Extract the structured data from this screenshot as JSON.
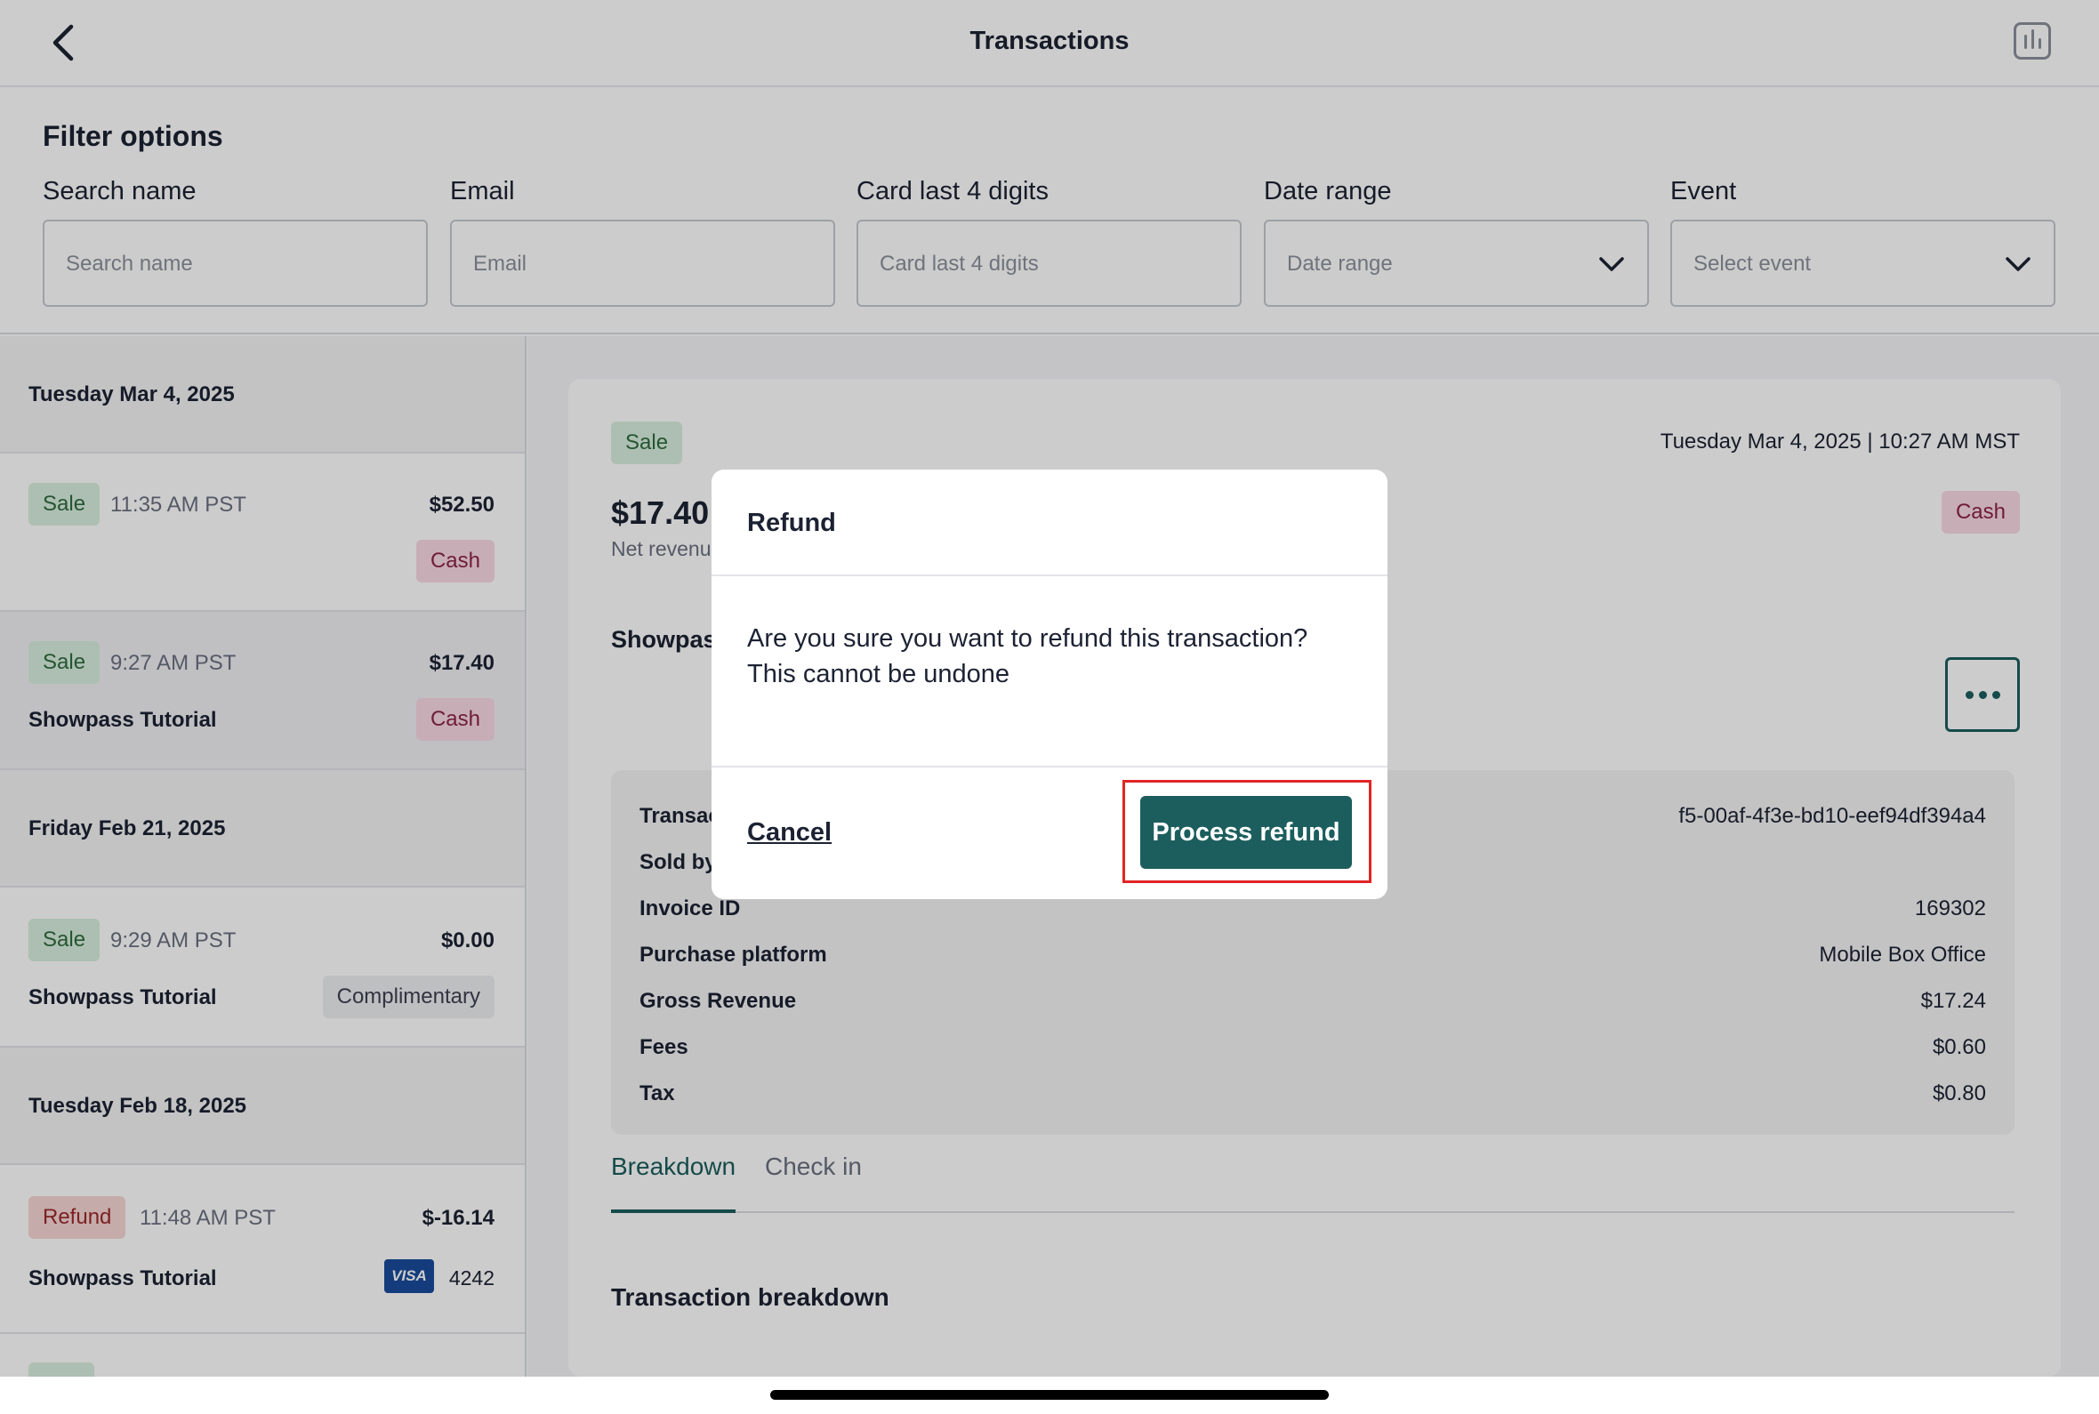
{
  "topbar": {
    "title": "Transactions",
    "back_icon": "chevron-left-icon",
    "report_icon": "bar-chart-icon"
  },
  "filters": {
    "title": "Filter options",
    "fields": [
      {
        "label": "Search name",
        "placeholder": "Search name",
        "type": "text"
      },
      {
        "label": "Email",
        "placeholder": "Email",
        "type": "text"
      },
      {
        "label": "Card last 4 digits",
        "placeholder": "Card last 4 digits",
        "type": "text"
      },
      {
        "label": "Date range",
        "placeholder": "Date range",
        "type": "select"
      },
      {
        "label": "Event",
        "placeholder": "Select event",
        "type": "select"
      }
    ]
  },
  "list": {
    "groups": [
      {
        "date": "Tuesday Mar 4, 2025",
        "items": [
          {
            "type": "Sale",
            "time": "11:35 AM PST",
            "amount": "$52.50",
            "event": "",
            "payment": "Cash"
          },
          {
            "type": "Sale",
            "time": "9:27 AM PST",
            "amount": "$17.40",
            "event": "Showpass Tutorial",
            "payment": "Cash",
            "selected": true
          }
        ]
      },
      {
        "date": "Friday Feb 21, 2025",
        "items": [
          {
            "type": "Sale",
            "time": "9:29 AM PST",
            "amount": "$0.00",
            "event": "Showpass Tutorial",
            "payment": "Complimentary"
          }
        ]
      },
      {
        "date": "Tuesday Feb 18, 2025",
        "items": [
          {
            "type": "Refund",
            "time": "11:48 AM PST",
            "amount": "$-16.14",
            "event": "Showpass Tutorial",
            "payment_card": "VISA",
            "card_last4": "4242"
          }
        ]
      }
    ]
  },
  "detail": {
    "type": "Sale",
    "datetime": "Tuesday Mar 4, 2025 | 10:27 AM MST",
    "total": "$17.40",
    "net_label": "Net revenu",
    "payment": "Cash",
    "event_name": "Showpas",
    "info": [
      {
        "key": "Transac",
        "value": "f5-00af-4f3e-bd10-eef94df394a4"
      },
      {
        "key": "Sold by",
        "value": ""
      },
      {
        "key": "Invoice ID",
        "value": "169302"
      },
      {
        "key": "Purchase platform",
        "value": "Mobile Box Office"
      },
      {
        "key": "Gross Revenue",
        "value": "$17.24"
      },
      {
        "key": "Fees",
        "value": "$0.60"
      },
      {
        "key": "Tax",
        "value": "$0.80"
      }
    ],
    "tabs": [
      "Breakdown",
      "Check in"
    ],
    "breakdown_title": "Transaction breakdown"
  },
  "modal": {
    "title": "Refund",
    "body": "Are you sure you want to refund this transaction? This cannot be undone",
    "cancel_label": "Cancel",
    "confirm_label": "Process refund"
  },
  "colors": {
    "accent": "#1b5e5d",
    "sale_bg": "#d9efdf",
    "refund_bg": "#f8d6d6",
    "cash_bg": "#f9d9e4",
    "highlight": "#e02525"
  }
}
